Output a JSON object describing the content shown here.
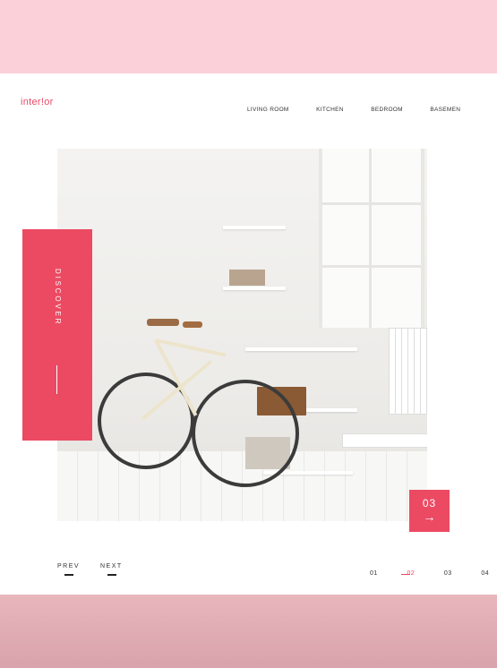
{
  "brand": {
    "logo": "inter!or",
    "accent": "#ec4a63"
  },
  "nav": {
    "items": [
      "LIVING ROOM",
      "KITCHEN",
      "BEDROOM",
      "BASEMEN"
    ]
  },
  "hero": {
    "discover_label": "DISCOVER",
    "slide_number": "03",
    "arrow": "→"
  },
  "pager": {
    "prev": "PREV",
    "next": "NEXT",
    "pages": [
      "01",
      "02",
      "03",
      "04"
    ],
    "active_page": "02"
  }
}
